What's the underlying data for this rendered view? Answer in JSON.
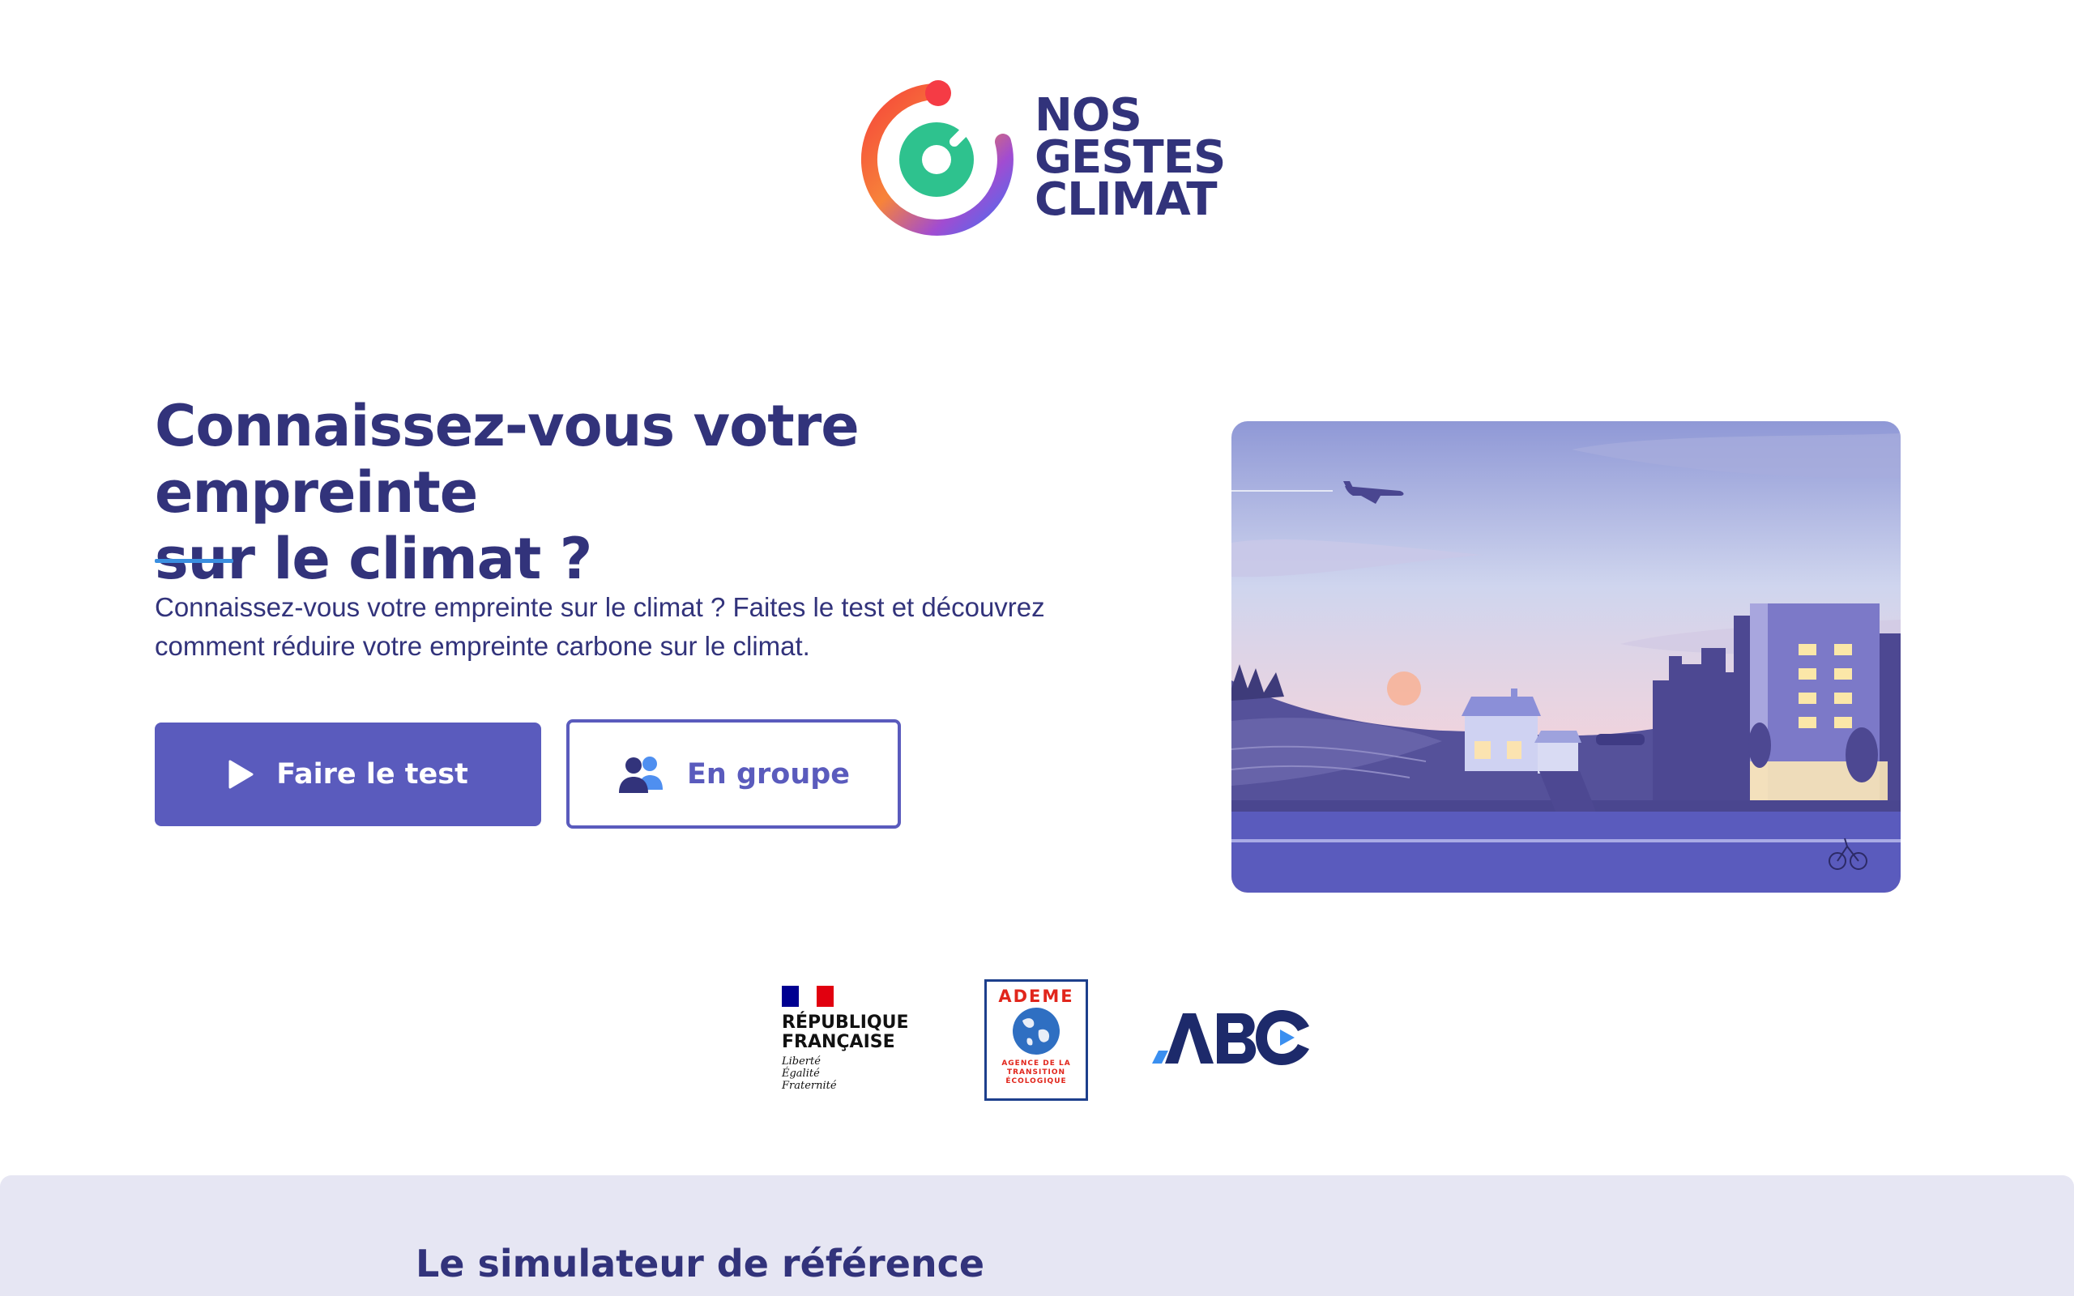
{
  "header": {
    "logo_lines": [
      "NOS",
      "GESTES",
      "CLIMAT"
    ]
  },
  "hero": {
    "title_line1": "Connaissez-vous votre empreinte",
    "title_line2": "sur le climat ?",
    "description_line1": "Connaissez-vous votre empreinte sur le climat ? Faites le test et découvrez",
    "description_line2": "comment réduire votre empreinte carbone sur le climat.",
    "primary_button": {
      "label": "Faire le test",
      "icon": "play-icon"
    },
    "secondary_button": {
      "label": "En groupe",
      "icon": "group-icon"
    }
  },
  "partners": {
    "republique": {
      "name_line1": "RÉPUBLIQUE",
      "name_line2": "FRANÇAISE",
      "motto": [
        "Liberté",
        "Égalité",
        "Fraternité"
      ]
    },
    "ademe": {
      "name": "ADEME",
      "sub_line1": "AGENCE DE LA",
      "sub_line2": "TRANSITION",
      "sub_line3": "ÉCOLOGIQUE"
    },
    "abc": {
      "name": "ABC"
    }
  },
  "section": {
    "title": "Le simulateur de référence"
  },
  "colors": {
    "brand_navy": "#32337b",
    "primary": "#5a5bbd",
    "accent_blue": "#3a8fe0",
    "band_bg": "#e6e6f3"
  }
}
